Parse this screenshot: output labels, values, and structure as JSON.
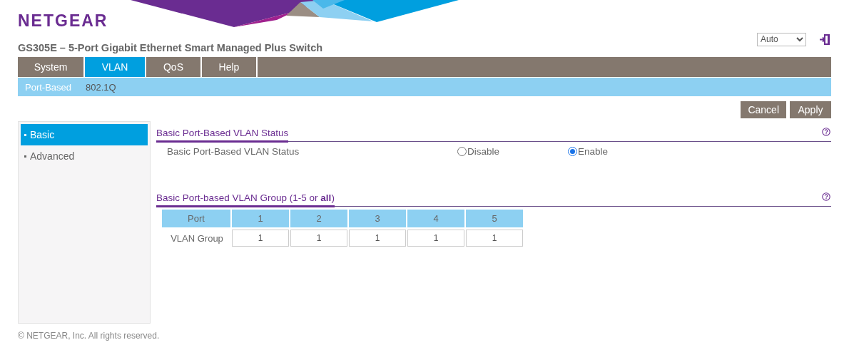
{
  "logo": "NETGEAR",
  "product_title": "GS305E – 5-Port Gigabit Ethernet Smart Managed Plus Switch",
  "language_select": {
    "value": "Auto"
  },
  "tabs": [
    {
      "label": "System",
      "selected": false
    },
    {
      "label": "VLAN",
      "selected": true
    },
    {
      "label": "QoS",
      "selected": false
    },
    {
      "label": "Help",
      "selected": false
    }
  ],
  "subtabs": [
    {
      "label": "Port-Based",
      "selected": true
    },
    {
      "label": "802.1Q",
      "selected": false
    }
  ],
  "buttons": [
    "Cancel",
    "Apply"
  ],
  "sidebar": {
    "items": [
      {
        "label": "Basic",
        "selected": true
      },
      {
        "label": "Advanced",
        "selected": false
      }
    ]
  },
  "status_section": {
    "title": "Basic Port-Based VLAN Status",
    "label": "Basic Port-Based VLAN Status",
    "options": [
      {
        "label": "Disable",
        "selected": false
      },
      {
        "label": "Enable",
        "selected": true
      }
    ]
  },
  "group_section": {
    "title": "Basic Port-based VLAN Group (1-5 or **all**)",
    "table": {
      "header_label": "Port",
      "row_label": "VLAN Group",
      "ports": [
        "1",
        "2",
        "3",
        "4",
        "5"
      ],
      "values": [
        "1",
        "1",
        "1",
        "1",
        "1"
      ]
    }
  },
  "footer": "© NETGEAR, Inc. All rights reserved."
}
